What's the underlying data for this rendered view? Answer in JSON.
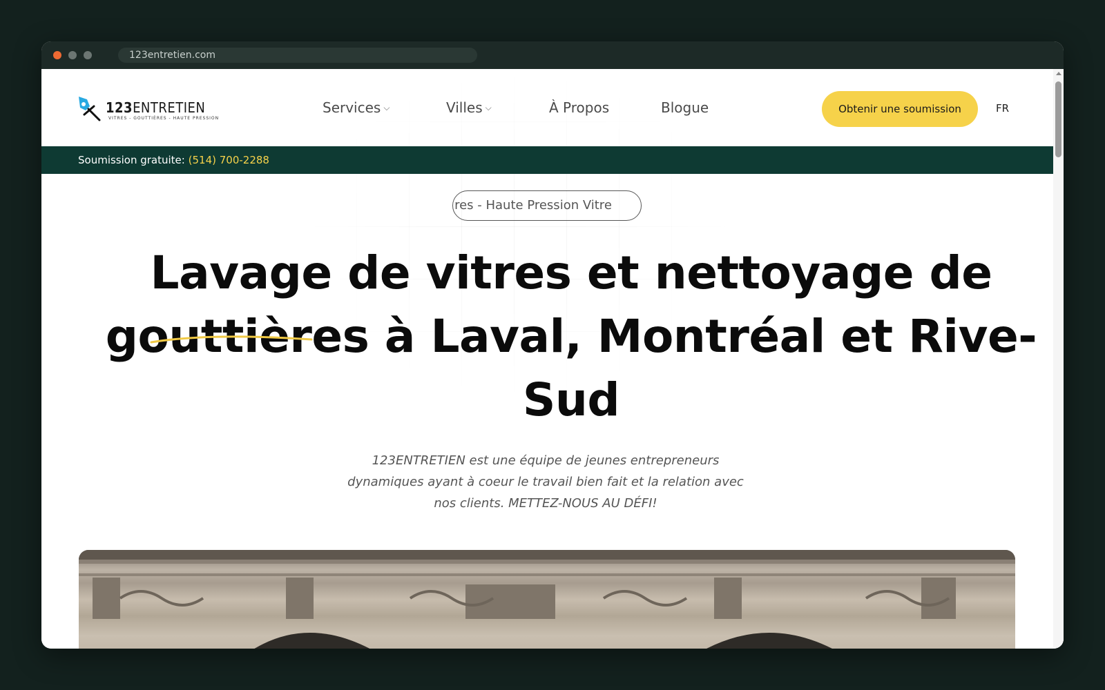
{
  "browser": {
    "url": "123entretien.com"
  },
  "header": {
    "logo_name": "ENTRETIEN",
    "logo_number": "123",
    "logo_tagline": "VITRES - GOUTTIÈRES - HAUTE PRESSION",
    "nav": [
      {
        "label": "Services",
        "has_dropdown": true
      },
      {
        "label": "Villes",
        "has_dropdown": true
      },
      {
        "label": "À Propos",
        "has_dropdown": false
      },
      {
        "label": "Blogue",
        "has_dropdown": false
      }
    ],
    "cta_label": "Obtenir une soumission",
    "language": "FR"
  },
  "phonebar": {
    "label": "Soumission gratuite:",
    "phone": "(514) 700-2288"
  },
  "hero": {
    "pill_text": "res - Haute Pression Vitre",
    "title": "Lavage de vitres et nettoyage de gouttières à Laval, Montréal et Rive-Sud",
    "subtitle": "123ENTRETIEN est une équipe de jeunes entrepreneurs dynamiques ayant à coeur le travail bien fait et la relation avec nos clients. METTEZ-NOUS AU DÉFI!"
  },
  "colors": {
    "accent_yellow": "#f6d24a",
    "brand_dark_green": "#0e3a33",
    "logo_blue": "#29a9e1"
  },
  "icons": {
    "dropdown": "chevron-down-icon",
    "logo": "squeegee-logo-icon"
  }
}
